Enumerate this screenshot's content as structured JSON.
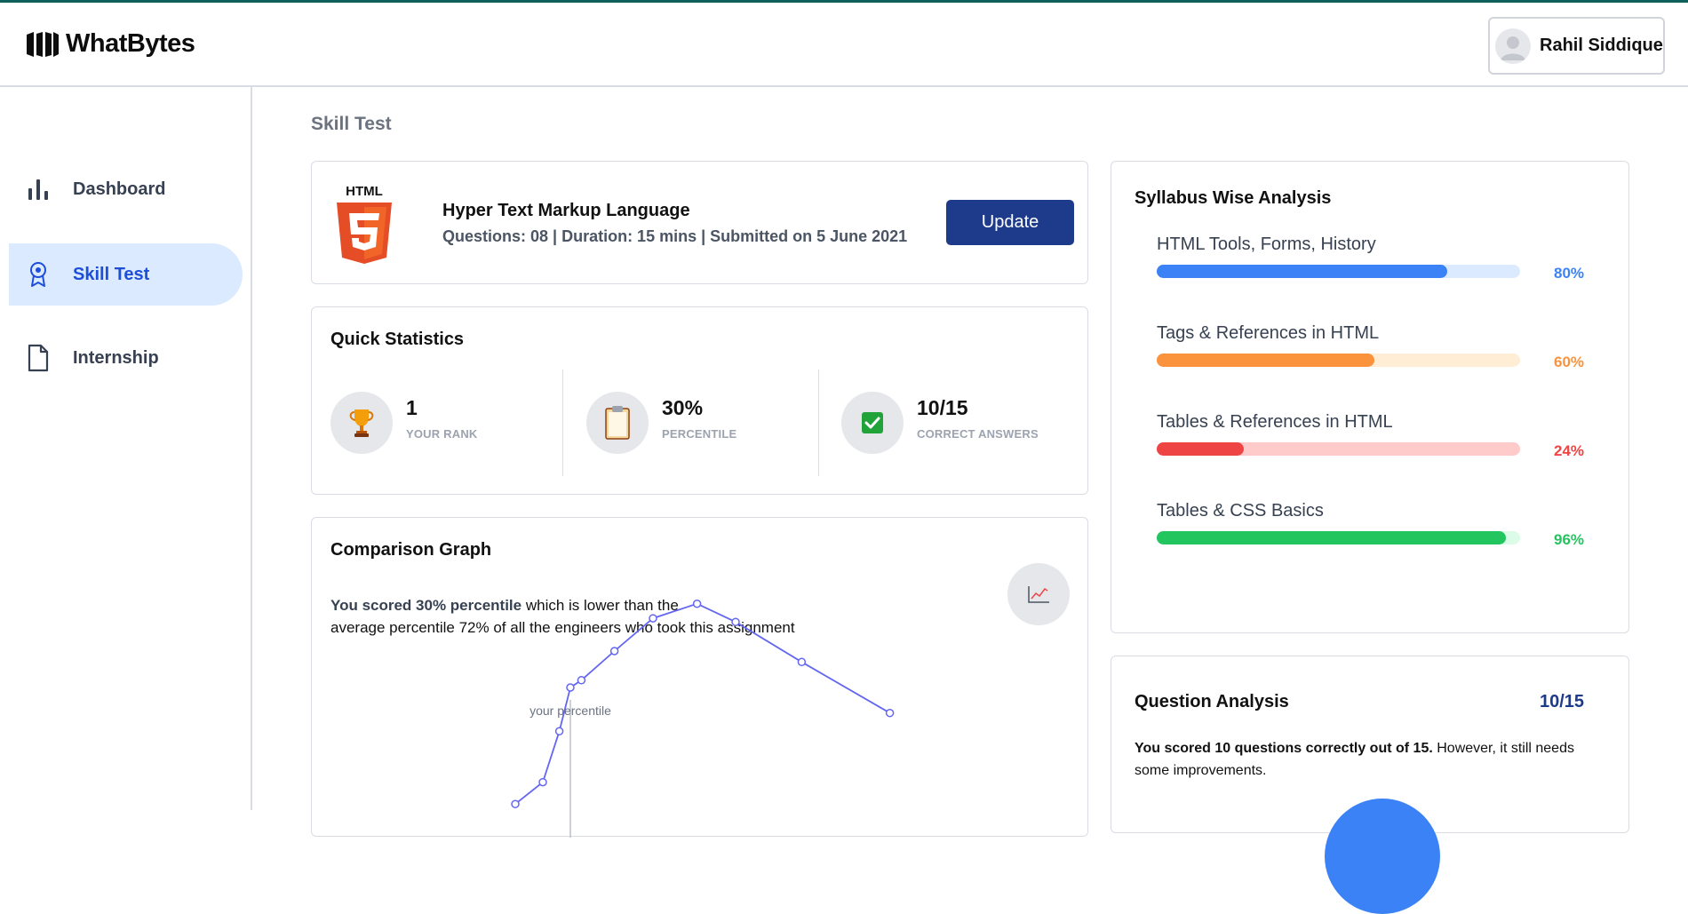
{
  "header": {
    "brand": "WhatBytes",
    "user_name": "Rahil Siddique"
  },
  "sidebar": {
    "items": [
      {
        "label": "Dashboard",
        "icon": "bar-chart-icon",
        "active": false
      },
      {
        "label": "Skill Test",
        "icon": "award-ribbon-icon",
        "active": true
      },
      {
        "label": "Internship",
        "icon": "file-icon",
        "active": false
      }
    ]
  },
  "page_title": "Skill Test",
  "test": {
    "logo_text": "HTML",
    "title": "Hyper Text Markup Language",
    "meta": "Questions: 08 | Duration: 15 mins | Submitted on 5 June 2021",
    "update_label": "Update"
  },
  "quick_stats": {
    "title": "Quick Statistics",
    "items": [
      {
        "value": "1",
        "label": "YOUR RANK",
        "icon": "trophy-icon"
      },
      {
        "value": "30%",
        "label": "PERCENTILE",
        "icon": "clipboard-icon"
      },
      {
        "value": "10/15",
        "label": "CORRECT ANSWERS",
        "icon": "check-box-icon"
      }
    ]
  },
  "comparison": {
    "title": "Comparison Graph",
    "text_bold": "You scored 30% percentile",
    "text_rest": " which is lower than the",
    "text_line2": "average percentile 72% of all the engineers who took this assignment",
    "graph_annotation": "your percentile",
    "icon": "line-chart-icon"
  },
  "chart_data": {
    "type": "line",
    "title": "",
    "xlabel": "",
    "ylabel": "",
    "annotation": {
      "text": "your percentile",
      "x": 30
    },
    "x": [
      20,
      25,
      28,
      30,
      32,
      38,
      45,
      53,
      60,
      72,
      88
    ],
    "series": [
      {
        "values": [
          8,
          14,
          28,
          40,
          42,
          50,
          59,
          63,
          58,
          47,
          33
        ]
      }
    ],
    "colors": {
      "line": "#6366f1"
    }
  },
  "syllabus": {
    "title": "Syllabus Wise Analysis",
    "items": [
      {
        "name": "HTML Tools, Forms, History",
        "value": 80,
        "pct": "80%",
        "color": "#3b82f6",
        "track": "#dbeafe"
      },
      {
        "name": "Tags & References in HTML",
        "value": 60,
        "pct": "60%",
        "color": "#fb923c",
        "track": "#ffedd5"
      },
      {
        "name": "Tables & References in HTML",
        "value": 24,
        "pct": "24%",
        "color": "#ef4444",
        "track": "#fecaca"
      },
      {
        "name": "Tables & CSS Basics",
        "value": 96,
        "pct": "96%",
        "color": "#22c55e",
        "track": "#dcfce7"
      }
    ]
  },
  "question_analysis": {
    "title": "Question Analysis",
    "score": "10/15",
    "text_bold": "You scored 10 questions correctly out of 15.",
    "text_rest": " However, it still needs some improvements."
  }
}
